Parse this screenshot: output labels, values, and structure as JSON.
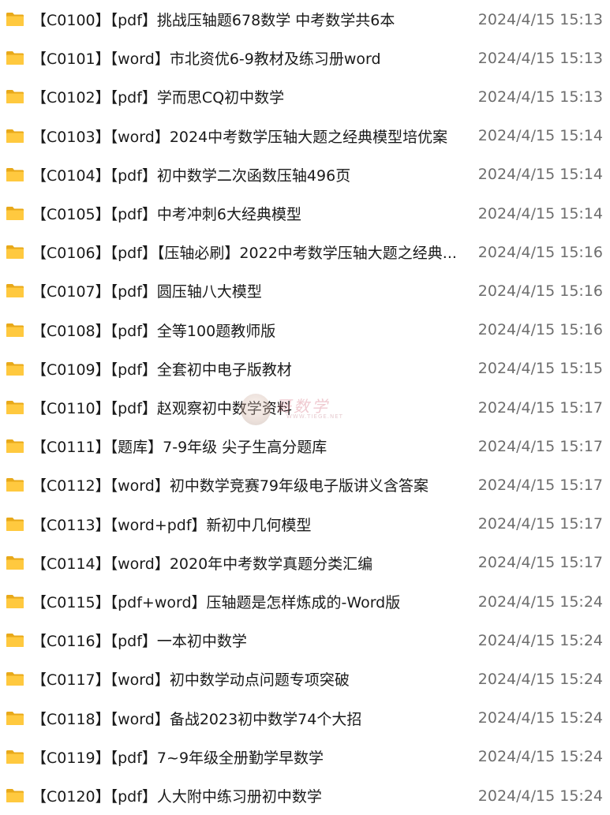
{
  "files": [
    {
      "name": "【C0100】【pdf】挑战压轴题678数学 中考数学共6本",
      "date": "2024/4/15 15:13"
    },
    {
      "name": "【C0101】【word】市北资优6-9教材及练习册word",
      "date": "2024/4/15 15:13"
    },
    {
      "name": "【C0102】【pdf】学而思CQ初中数学",
      "date": "2024/4/15 15:13"
    },
    {
      "name": "【C0103】【word】2024中考数学压轴大题之经典模型培优案",
      "date": "2024/4/15 15:14"
    },
    {
      "name": "【C0104】【pdf】初中数学二次函数压轴496页",
      "date": "2024/4/15 15:14"
    },
    {
      "name": "【C0105】【pdf】中考冲刺6大经典模型",
      "date": "2024/4/15 15:14"
    },
    {
      "name": "【C0106】【pdf】【压轴必刷】2022中考数学压轴大题之经典...",
      "date": "2024/4/15 15:16"
    },
    {
      "name": "【C0107】【pdf】圆压轴八大模型",
      "date": "2024/4/15 15:16"
    },
    {
      "name": "【C0108】【pdf】全等100题教师版",
      "date": "2024/4/15 15:16"
    },
    {
      "name": "【C0109】【pdf】全套初中电子版教材",
      "date": "2024/4/15 15:15"
    },
    {
      "name": "【C0110】【pdf】赵观察初中数学资料",
      "date": "2024/4/15 15:17"
    },
    {
      "name": "【C0111】【题库】7-9年级 尖子生高分题库",
      "date": "2024/4/15 15:17"
    },
    {
      "name": "【C0112】【word】初中数学竞赛79年级电子版讲义含答案",
      "date": "2024/4/15 15:17"
    },
    {
      "name": "【C0113】【word+pdf】新初中几何模型",
      "date": "2024/4/15 15:17"
    },
    {
      "name": "【C0114】【word】2020年中考数学真题分类汇编",
      "date": "2024/4/15 15:17"
    },
    {
      "name": "【C0115】【pdf+word】压轴题是怎样炼成的-Word版",
      "date": "2024/4/15 15:24"
    },
    {
      "name": "【C0116】【pdf】一本初中数学",
      "date": "2024/4/15 15:24"
    },
    {
      "name": "【C0117】【word】初中数学动点问题专项突破",
      "date": "2024/4/15 15:24"
    },
    {
      "name": "【C0118】【word】备战2023初中数学74个大招",
      "date": "2024/4/15 15:24"
    },
    {
      "name": "【C0119】【pdf】7~9年级全册勤学早数学",
      "date": "2024/4/15 15:24"
    },
    {
      "name": "【C0120】【pdf】人大附中练习册初中数学",
      "date": "2024/4/15 15:24"
    }
  ],
  "icon": "folder-icon",
  "colors": {
    "folder_back": "#e8a91a",
    "folder_front": "#ffc93f",
    "name_text": "#1a1a1a",
    "date_text": "#6d6d6d"
  },
  "watermark": {
    "text": "哥数学",
    "sub": "WWW.TIEGE.NET"
  }
}
